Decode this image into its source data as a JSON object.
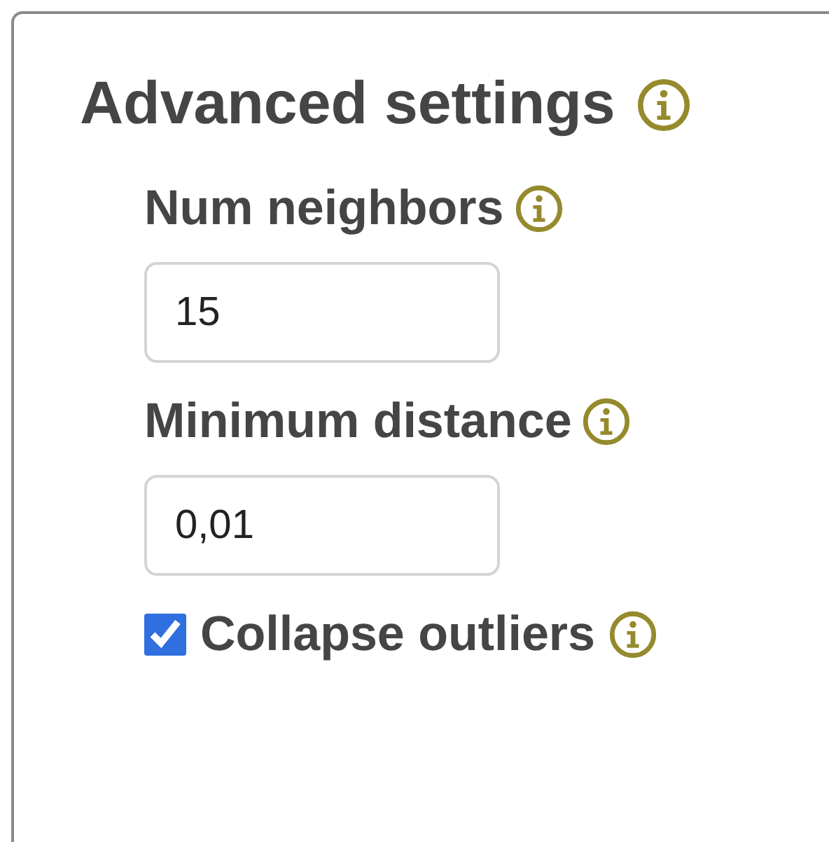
{
  "panel": {
    "title": "Advanced settings",
    "fields": [
      {
        "kind": "input",
        "label": "Num neighbors",
        "value": "15"
      },
      {
        "kind": "input",
        "label": "Minimum distance",
        "value": "0,01"
      },
      {
        "kind": "checkbox",
        "label": "Collapse outliers",
        "checked": true
      }
    ]
  }
}
